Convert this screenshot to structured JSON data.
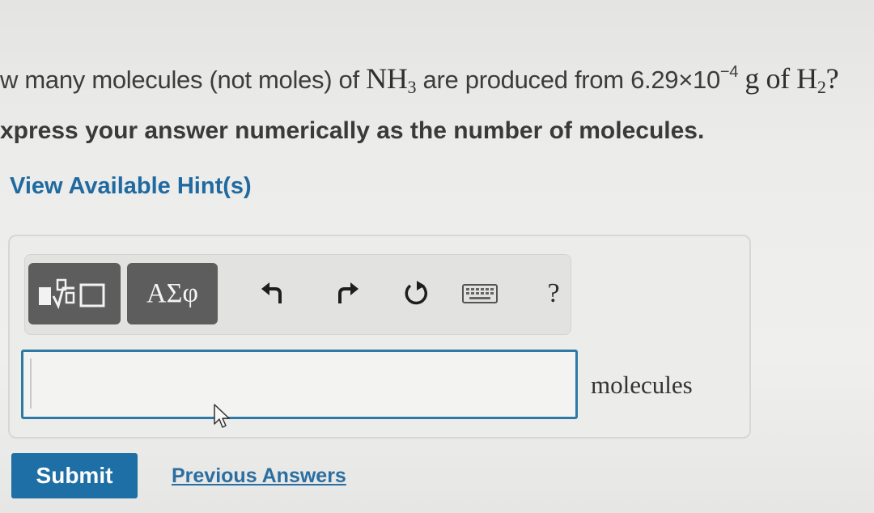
{
  "question": {
    "prefix": "w many molecules (not moles) of ",
    "compound": "NH",
    "compound_sub": "3",
    "mid": " are produced from ",
    "mass_mantissa": "6.29×10",
    "mass_exponent": "−4",
    "mass_unit": "g",
    "of_text": "of",
    "reactant": "H",
    "reactant_sub": "2",
    "end_fragment": "?"
  },
  "instruction": "xpress your answer numerically as the number of molecules.",
  "hint_link": "View Available Hint(s)",
  "toolbar": {
    "templates_icon": "templates-icon",
    "greek_label": "ΑΣφ",
    "undo_icon": "undo-icon",
    "redo_icon": "redo-icon",
    "reset_icon": "reset-icon",
    "keyboard_icon": "keyboard-icon",
    "help_label": "?"
  },
  "answer": {
    "value": "",
    "unit": "molecules"
  },
  "submit_label": "Submit",
  "previous_answers_label": "Previous Answers",
  "colors": {
    "accent": "#1d6fa6",
    "link": "#1f6aa0",
    "toolbar_button": "#5d5d5d",
    "input_border": "#2d7aa6"
  }
}
